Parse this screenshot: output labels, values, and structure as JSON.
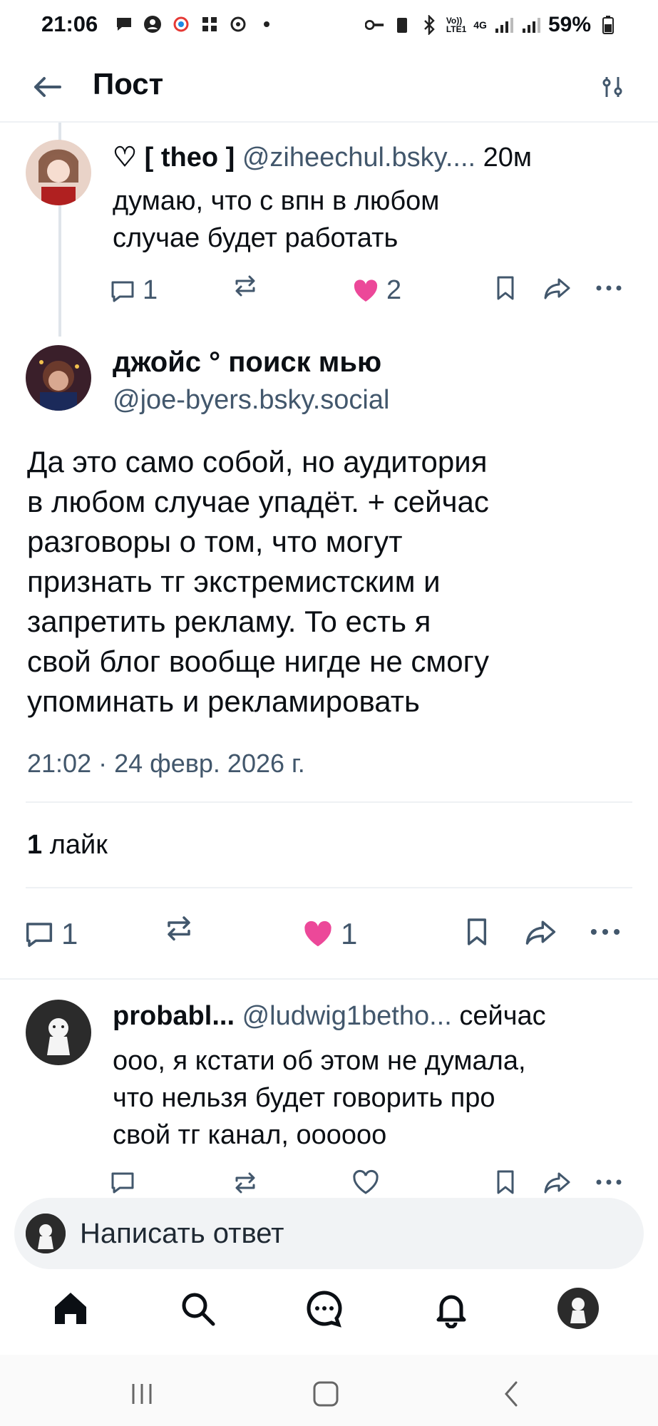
{
  "status_bar": {
    "time": "21:06",
    "network_vo": "Vo))",
    "network_lte": "LTE1",
    "network_4g": "4G",
    "battery": "59%"
  },
  "header": {
    "title": "Пост"
  },
  "parent_post": {
    "display_name": "♡ [ theo ]",
    "handle": "@ziheechul.bsky....",
    "time": "20м",
    "text_line1": "думаю, что с впн в любом",
    "text_line2": "случае будет работать",
    "reply_count": "1",
    "like_count": "2"
  },
  "main_post": {
    "display_name": "джойс ° поиск мью",
    "handle": "@joe-byers.bsky.social",
    "text_lines": [
      "Да это само собой, но аудитория",
      "в любом случае упадёт. + сейчас",
      "разговоры о том, что могут",
      "признать тг экстремистским и",
      "запретить рекламу. То есть я",
      "свой блог вообще нигде не смогу",
      "упоминать и рекламировать"
    ],
    "date": "21:02 · 24 февр. 2026 г.",
    "likes_count": "1",
    "likes_label": "лайк",
    "reply_count": "1",
    "like_count": "1"
  },
  "reply_post": {
    "display_name": "probabl...",
    "handle": "@ludwig1betho...",
    "time": "сейчас",
    "text_line1": "ооо, я кстати об этом не думала,",
    "text_line2": "что нельзя будет говорить про",
    "text_line3": "свой тг канал, оооооо"
  },
  "composer": {
    "placeholder": "Написать ответ"
  },
  "colors": {
    "like_pink": "#ec4899",
    "icon_gray": "#42576c"
  }
}
